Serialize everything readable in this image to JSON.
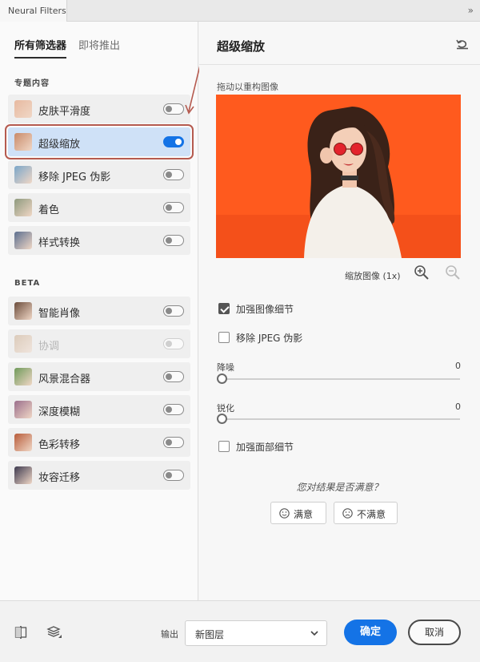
{
  "window": {
    "tab_title": "Neural Filters",
    "collapse_glyph": "»"
  },
  "left_panel": {
    "tabs": [
      "所有筛选器",
      "即将推出"
    ],
    "sections": [
      {
        "title": "专题内容",
        "filters": [
          {
            "label": "皮肤平滑度",
            "enabled": false,
            "disabled": false,
            "thumb_color": "#e7b9a0"
          },
          {
            "label": "超级缩放",
            "enabled": true,
            "disabled": false,
            "thumb_color": "#c98b6a"
          },
          {
            "label": "移除 JPEG 伪影",
            "enabled": false,
            "disabled": false,
            "thumb_color": "#7aa6c9"
          },
          {
            "label": "着色",
            "enabled": false,
            "disabled": false,
            "thumb_color": "#8e9a7e"
          },
          {
            "label": "样式转换",
            "enabled": false,
            "disabled": false,
            "thumb_color": "#5c6f8f"
          }
        ]
      },
      {
        "title": "BETA",
        "filters": [
          {
            "label": "智能肖像",
            "enabled": false,
            "disabled": false,
            "thumb_color": "#6b4c3b"
          },
          {
            "label": "协调",
            "enabled": false,
            "disabled": true,
            "thumb_color": "#c4a07b"
          },
          {
            "label": "风景混合器",
            "enabled": false,
            "disabled": false,
            "thumb_color": "#6f9a5a"
          },
          {
            "label": "深度模糊",
            "enabled": false,
            "disabled": false,
            "thumb_color": "#9b6f8c"
          },
          {
            "label": "色彩转移",
            "enabled": false,
            "disabled": false,
            "thumb_color": "#b85c3a"
          },
          {
            "label": "妆容迁移",
            "enabled": false,
            "disabled": false,
            "thumb_color": "#3d3a4f"
          }
        ]
      }
    ]
  },
  "right_panel": {
    "title": "超级缩放",
    "caption": "拖动以重构图像",
    "zoom_label": "缩放图像 (1x)",
    "options": {
      "enhance_detail": {
        "label": "加强图像细节",
        "checked": true
      },
      "remove_jpeg": {
        "label": "移除 JPEG 伪影",
        "checked": false
      },
      "enhance_face": {
        "label": "加强面部细节",
        "checked": false
      }
    },
    "sliders": {
      "noise": {
        "label": "降噪",
        "value": "0"
      },
      "sharpen": {
        "label": "锐化",
        "value": "0"
      }
    },
    "feedback": {
      "question": "您对结果是否满意？",
      "yes": "满意",
      "no": "不满意"
    }
  },
  "footer": {
    "output_label": "输出",
    "output_value": "新图层",
    "ok": "确定",
    "cancel": "取消"
  },
  "colors": {
    "accent": "#1473e6",
    "highlight_border": "#b55a4f",
    "preview_bg": "#ff5a1e"
  }
}
